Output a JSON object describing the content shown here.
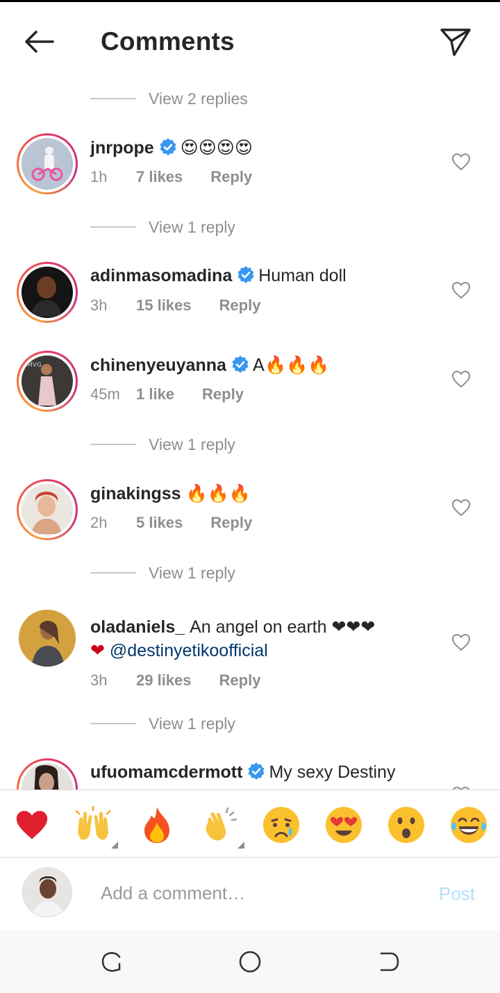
{
  "header": {
    "title": "Comments",
    "back_icon": "arrow-left-icon",
    "send_icon": "paper-plane-icon"
  },
  "comments": {
    "view_replies": [
      {
        "label": "View 2 replies"
      },
      {
        "label": "View 1 reply"
      },
      {
        "label": "View 1 reply"
      },
      {
        "label": "View 1 reply"
      },
      {
        "label": "View 1 reply"
      }
    ],
    "items": [
      {
        "username": "jnrpope",
        "verified": true,
        "text": "😍😍😍😍",
        "time": "1h",
        "likes": "7 likes",
        "reply": "Reply"
      },
      {
        "username": "adinmasomadina",
        "verified": true,
        "text": "Human doll",
        "time": "3h",
        "likes": "15 likes",
        "reply": "Reply"
      },
      {
        "username": "chinenyeuyanna",
        "verified": true,
        "text": "A🔥🔥🔥",
        "time": "45m",
        "likes": "1 like",
        "reply": "Reply"
      },
      {
        "username": "ginakingss",
        "verified": false,
        "text": "🔥🔥🔥",
        "time": "2h",
        "likes": "5 likes",
        "reply": "Reply"
      },
      {
        "username": "oladaniels_",
        "verified": false,
        "text": "An angel on earth ❤❤❤",
        "text2": "❤",
        "mention": "@destinyetikoofficial",
        "time": "3h",
        "likes": "29 likes",
        "reply": "Reply"
      },
      {
        "username": "ufuomamcdermott",
        "verified": true,
        "text": "My sexy Destiny"
      }
    ]
  },
  "reactions": [
    {
      "emoji": "❤",
      "icon": "red-heart-emoji"
    },
    {
      "emoji": "🙌",
      "icon": "raising-hands-emoji",
      "has_variants": true
    },
    {
      "emoji": "🔥",
      "icon": "fire-emoji"
    },
    {
      "emoji": "👏",
      "icon": "clapping-hands-emoji",
      "has_variants": true
    },
    {
      "emoji": "😢",
      "icon": "crying-face-emoji"
    },
    {
      "emoji": "😍",
      "icon": "heart-eyes-emoji"
    },
    {
      "emoji": "😮",
      "icon": "surprised-face-emoji"
    },
    {
      "emoji": "😂",
      "icon": "tears-of-joy-emoji"
    }
  ],
  "composer": {
    "placeholder": "Add a comment…",
    "post_label": "Post"
  },
  "colors": {
    "verified_blue": "#3897f0",
    "mention_blue": "#00376b",
    "post_disabled": "#b2dffc",
    "meta_gray": "#8e8e8e"
  }
}
